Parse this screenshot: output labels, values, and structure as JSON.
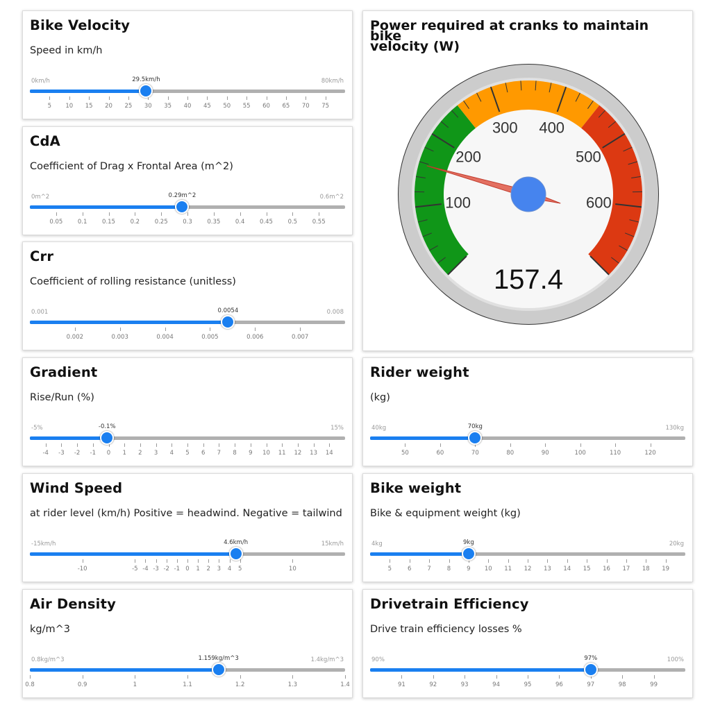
{
  "sliders": [
    {
      "id": "velocity",
      "title": "Bike Velocity",
      "description": "Speed in km/h",
      "min_label": "0km/h",
      "max_label": "80km/h",
      "value_label": "29.5km/h",
      "min": 0,
      "max": 80,
      "value": 29.5,
      "ticks": [
        [
          5,
          "5"
        ],
        [
          10,
          "10"
        ],
        [
          15,
          "15"
        ],
        [
          20,
          "20"
        ],
        [
          25,
          "25"
        ],
        [
          30,
          "30"
        ],
        [
          35,
          "35"
        ],
        [
          40,
          "40"
        ],
        [
          45,
          "45"
        ],
        [
          50,
          "50"
        ],
        [
          55,
          "55"
        ],
        [
          60,
          "60"
        ],
        [
          65,
          "65"
        ],
        [
          70,
          "70"
        ],
        [
          75,
          "75"
        ]
      ]
    },
    {
      "id": "cda",
      "title": "CdA",
      "description": "Coefficient of Drag x Frontal Area (m^2)",
      "min_label": "0m^2",
      "max_label": "0.6m^2",
      "value_label": "0.29m^2",
      "min": 0,
      "max": 0.6,
      "value": 0.29,
      "ticks": [
        [
          0.05,
          "0.05"
        ],
        [
          0.1,
          "0.1"
        ],
        [
          0.15,
          "0.15"
        ],
        [
          0.2,
          "0.2"
        ],
        [
          0.25,
          "0.25"
        ],
        [
          0.3,
          "0.3"
        ],
        [
          0.35,
          "0.35"
        ],
        [
          0.4,
          "0.4"
        ],
        [
          0.45,
          "0.45"
        ],
        [
          0.5,
          "0.5"
        ],
        [
          0.55,
          "0.55"
        ]
      ]
    },
    {
      "id": "crr",
      "title": "Crr",
      "description": "Coefficient of rolling resistance (unitless)",
      "min_label": "0.001",
      "max_label": "0.008",
      "value_label": "0.0054",
      "min": 0.001,
      "max": 0.008,
      "value": 0.0054,
      "ticks": [
        [
          0.002,
          "0.002"
        ],
        [
          0.003,
          "0.003"
        ],
        [
          0.004,
          "0.004"
        ],
        [
          0.005,
          "0.005"
        ],
        [
          0.006,
          "0.006"
        ],
        [
          0.007,
          "0.007"
        ]
      ]
    },
    {
      "id": "gradient",
      "title": "Gradient",
      "description": "Rise/Run (%)",
      "min_label": "-5%",
      "max_label": "15%",
      "value_label": "-0.1%",
      "min": -5,
      "max": 15,
      "value": -0.1,
      "ticks": [
        [
          -4,
          "-4"
        ],
        [
          -3,
          "-3"
        ],
        [
          -2,
          "-2"
        ],
        [
          -1,
          "-1"
        ],
        [
          0,
          "0"
        ],
        [
          1,
          "1"
        ],
        [
          2,
          "2"
        ],
        [
          3,
          "3"
        ],
        [
          4,
          "4"
        ],
        [
          5,
          "5"
        ],
        [
          6,
          "6"
        ],
        [
          7,
          "7"
        ],
        [
          8,
          "8"
        ],
        [
          9,
          "9"
        ],
        [
          10,
          "10"
        ],
        [
          11,
          "11"
        ],
        [
          12,
          "12"
        ],
        [
          13,
          "13"
        ],
        [
          14,
          "14"
        ]
      ]
    },
    {
      "id": "rider",
      "title": "Rider weight",
      "description": "(kg)",
      "min_label": "40kg",
      "max_label": "130kg",
      "value_label": "70kg",
      "min": 40,
      "max": 130,
      "value": 70,
      "ticks": [
        [
          50,
          "50"
        ],
        [
          60,
          "60"
        ],
        [
          70,
          "70"
        ],
        [
          80,
          "80"
        ],
        [
          90,
          "90"
        ],
        [
          100,
          "100"
        ],
        [
          110,
          "110"
        ],
        [
          120,
          "120"
        ]
      ]
    },
    {
      "id": "wind",
      "title": "Wind Speed",
      "description": "at rider level (km/h) Positive = headwind. Negative = tailwind",
      "min_label": "-15km/h",
      "max_label": "15km/h",
      "value_label": "4.6km/h",
      "min": -15,
      "max": 15,
      "value": 4.6,
      "ticks": [
        [
          -10,
          "-10"
        ],
        [
          -5,
          "-5"
        ],
        [
          -4,
          "-4"
        ],
        [
          -3,
          "-3"
        ],
        [
          -2,
          "-2"
        ],
        [
          -1,
          "-1"
        ],
        [
          0,
          "0"
        ],
        [
          1,
          "1"
        ],
        [
          2,
          "2"
        ],
        [
          3,
          "3"
        ],
        [
          4,
          "4"
        ],
        [
          5,
          "5"
        ],
        [
          10,
          "10"
        ]
      ]
    },
    {
      "id": "bike",
      "title": "Bike weight",
      "description": "Bike & equipment weight (kg)",
      "min_label": "4kg",
      "max_label": "20kg",
      "value_label": "9kg",
      "min": 4,
      "max": 20,
      "value": 9,
      "ticks": [
        [
          5,
          "5"
        ],
        [
          6,
          "6"
        ],
        [
          7,
          "7"
        ],
        [
          8,
          "8"
        ],
        [
          9,
          "9"
        ],
        [
          10,
          "10"
        ],
        [
          11,
          "11"
        ],
        [
          12,
          "12"
        ],
        [
          13,
          "13"
        ],
        [
          14,
          "14"
        ],
        [
          15,
          "15"
        ],
        [
          16,
          "16"
        ],
        [
          17,
          "17"
        ],
        [
          18,
          "18"
        ],
        [
          19,
          "19"
        ]
      ]
    },
    {
      "id": "air",
      "title": "Air Density",
      "description": "kg/m^3",
      "min_label": "0.8kg/m^3",
      "max_label": "1.4kg/m^3",
      "value_label": "1.159kg/m^3",
      "min": 0.8,
      "max": 1.4,
      "value": 1.159,
      "ticks": [
        [
          0.8,
          "0.8"
        ],
        [
          0.9,
          "0.9"
        ],
        [
          1.0,
          "1"
        ],
        [
          1.1,
          "1.1"
        ],
        [
          1.2,
          "1.2"
        ],
        [
          1.3,
          "1.3"
        ],
        [
          1.4,
          "1.4"
        ]
      ]
    },
    {
      "id": "drivetrain",
      "title": "Drivetrain Efficiency",
      "description": "Drive train efficiency losses %",
      "min_label": "90%",
      "max_label": "100%",
      "value_label": "97%",
      "min": 90,
      "max": 100,
      "value": 97,
      "ticks": [
        [
          91,
          "91"
        ],
        [
          92,
          "92"
        ],
        [
          93,
          "93"
        ],
        [
          94,
          "94"
        ],
        [
          95,
          "95"
        ],
        [
          96,
          "96"
        ],
        [
          97,
          "97"
        ],
        [
          98,
          "98"
        ],
        [
          99,
          "99"
        ]
      ]
    }
  ],
  "gauge": {
    "title_line1": "Power required at cranks to maintain bike",
    "title_line2": "velocity (W)",
    "value": 157.4,
    "value_label": "157.4",
    "min": 0,
    "max": 700,
    "major_labels": [
      "100",
      "200",
      "300",
      "400",
      "500",
      "600"
    ],
    "bands": [
      {
        "from": 0,
        "to": 250,
        "color": "#109618"
      },
      {
        "from": 250,
        "to": 450,
        "color": "#ff9900"
      },
      {
        "from": 450,
        "to": 700,
        "color": "#dc3912"
      }
    ],
    "colors": {
      "needle": "#e06050",
      "hub": "#4684ee",
      "rim": "#cccccc",
      "face": "#f7f7f7"
    }
  }
}
